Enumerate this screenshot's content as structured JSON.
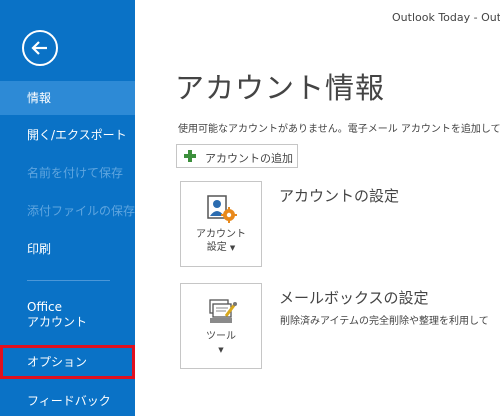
{
  "window_title": "Outlook Today - Outl",
  "sidebar": {
    "items": [
      {
        "label": "情報"
      },
      {
        "label": "開く/エクスポート"
      },
      {
        "label": "名前を付けて保存"
      },
      {
        "label": "添付ファイルの保存"
      },
      {
        "label": "印刷"
      },
      {
        "label_line1": "Office",
        "label_line2": "アカウント"
      },
      {
        "label": "オプション"
      },
      {
        "label": "フィードバック"
      }
    ]
  },
  "main": {
    "title": "アカウント情報",
    "info_text": "使用可能なアカウントがありません。電子メール アカウントを追加して、",
    "add_account_label": "アカウントの追加",
    "account_settings": {
      "tile_line1": "アカウント",
      "tile_line2": "設定",
      "title": "アカウントの設定"
    },
    "mailbox_settings": {
      "tile_line1": "ツール",
      "title": "メールボックスの設定",
      "description": "削除済みアイテムの完全削除や整理を利用して"
    }
  },
  "colors": {
    "sidebar_bg": "#0a72c6",
    "sidebar_active": "#2d8ad6",
    "highlight_border": "#e0101e",
    "add_icon": "#3c8f3c"
  },
  "icons": [
    "back-arrow-icon",
    "plus-icon",
    "account-settings-icon",
    "tools-icon",
    "caret-down-icon"
  ]
}
